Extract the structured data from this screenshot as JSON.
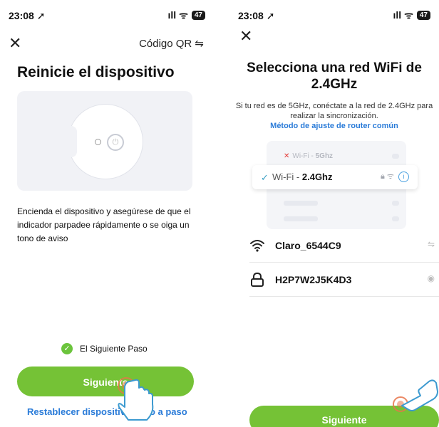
{
  "left": {
    "status": {
      "time": "23:08 ➚",
      "signal": "ıll ᯤ",
      "battery": "47"
    },
    "close": "✕",
    "qr_label": "Código QR ⇋",
    "title": "Reinicie el dispositivo",
    "instructions": "Encienda el dispositivo y asegúrese de que el indicador parpadee rápidamente o se oiga un tono de aviso",
    "step_label": "El Siguiente Paso",
    "next_button": "Siguiente",
    "reset_link": "Restablecer dispositivo paso a paso"
  },
  "right": {
    "status": {
      "time": "23:08 ➚",
      "signal": "ıll ᯤ",
      "battery": "47"
    },
    "close": "✕",
    "title": "Selecciona una red WiFi de 2.4GHz",
    "subtitle": "Si tu red es de 5GHz, conéctate a la red de 2.4GHz para realizar la sincronización.",
    "router_link": "Método de ajuste de router común",
    "wifi5": {
      "prefix": "Wi-Fi - ",
      "band": "5Ghz"
    },
    "wifi24": {
      "prefix": "Wi-Fi - ",
      "band": "2.4Ghz"
    },
    "network_name": "Claro_6544C9",
    "password": "H2P7W2J5K4D3",
    "next_button": "Siguiente"
  },
  "colors": {
    "green": "#75c236",
    "link": "#2a7bd8",
    "check": "#6bc43c",
    "tap": "#e8744a"
  },
  "icons": [
    "close-icon",
    "swap-icon",
    "power-icon",
    "check-icon",
    "hand-pointer-icon",
    "wifi-icon",
    "lock-icon",
    "eye-icon",
    "info-icon"
  ]
}
